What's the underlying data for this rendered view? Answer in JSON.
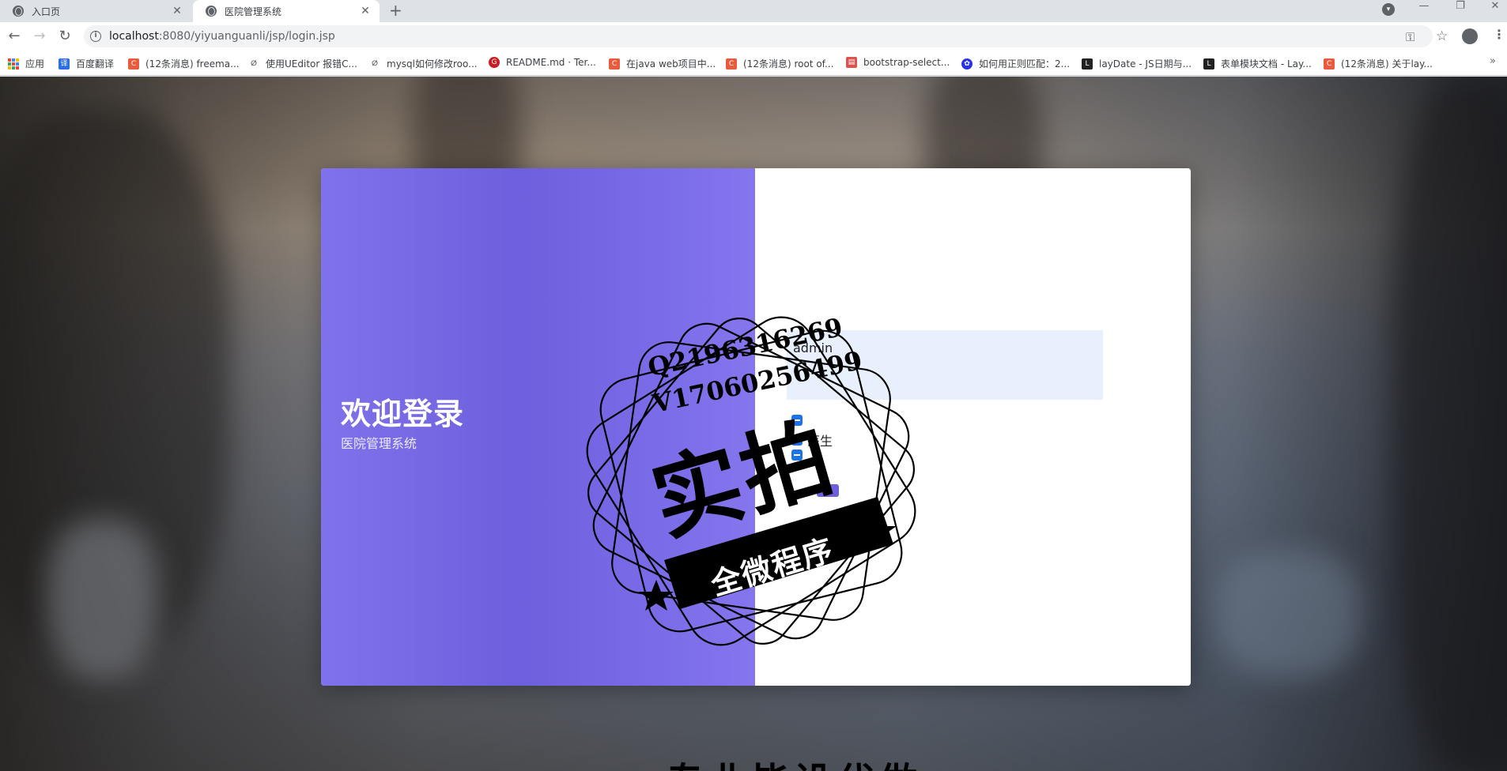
{
  "tabs": [
    {
      "label": "入口页"
    },
    {
      "label": "医院管理系统"
    }
  ],
  "toolbar": {
    "url_host": "localhost",
    "url_rest": ":8080/yiyuanguanli/jsp/login.jsp"
  },
  "bookmarks": [
    {
      "label": "应用",
      "icon": "apps-icon"
    },
    {
      "label": "百度翻译",
      "icon": "translate-icon",
      "color": "#2b6fe3"
    },
    {
      "label": "(12条消息) freema...",
      "icon": "csdn-icon",
      "color": "#e85b3c"
    },
    {
      "label": "使用UEditor 报错C...",
      "icon": "ueditor-icon",
      "color": "#555555"
    },
    {
      "label": "mysql如何修改roo...",
      "icon": "ueditor-icon",
      "color": "#555555"
    },
    {
      "label": "README.md · Ter...",
      "icon": "gitee-icon",
      "color": "#c71d23"
    },
    {
      "label": "在java web项目中...",
      "icon": "csdn-icon",
      "color": "#e85b3c"
    },
    {
      "label": "(12条消息) root of...",
      "icon": "csdn-icon",
      "color": "#e85b3c"
    },
    {
      "label": "bootstrap-select...",
      "icon": "doc-icon",
      "color": "#d9534f"
    },
    {
      "label": "如何用正则匹配：2...",
      "icon": "baidu-icon",
      "color": "#2932e1"
    },
    {
      "label": "layDate - JS日期与...",
      "icon": "layui-icon",
      "color": "#222222"
    },
    {
      "label": "表单模块文档 - Lay...",
      "icon": "layui-icon",
      "color": "#222222"
    },
    {
      "label": "(12条消息) 关于lay...",
      "icon": "csdn-icon",
      "color": "#e85b3c"
    }
  ],
  "login": {
    "welcome_title": "欢迎登录",
    "welcome_subtitle": "医院管理系统",
    "username_value": "admin",
    "role_doctor": "医生",
    "accent_color": "#7468e6"
  },
  "watermark": {
    "line1": "Q2196316269",
    "line2": "V17060256499",
    "big": "实拍",
    "ribbon": "全微程序",
    "bottom": "专业毕设代做"
  }
}
